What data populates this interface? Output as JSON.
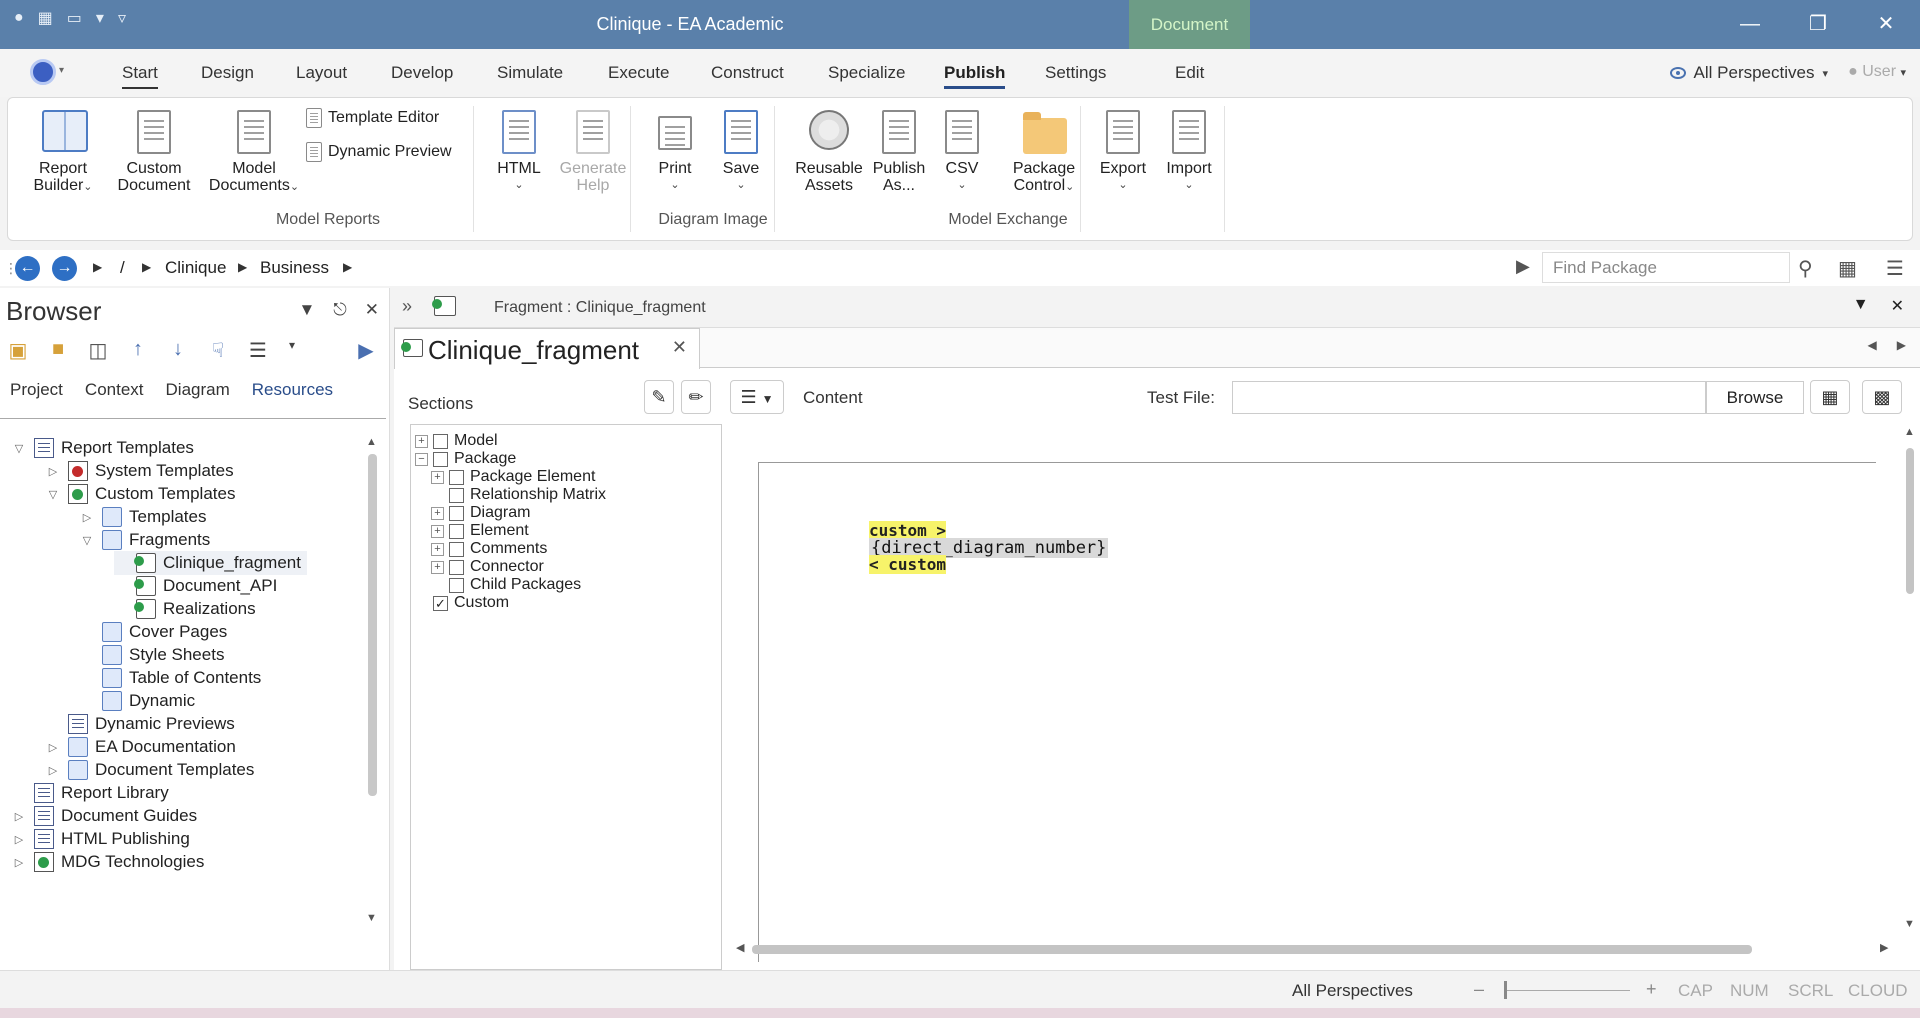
{
  "titlebar": {
    "title": "Clinique - EA Academic",
    "context_tab": "Document",
    "minimize": "—",
    "restore": "❐",
    "close": "✕"
  },
  "ribbon_tabs": {
    "start": "Start",
    "design": "Design",
    "layout": "Layout",
    "develop": "Develop",
    "simulate": "Simulate",
    "execute": "Execute",
    "construct": "Construct",
    "specialize": "Specialize",
    "publish": "Publish",
    "settings": "Settings",
    "edit": "Edit",
    "perspectives": "All Perspectives",
    "user": "User"
  },
  "ribbon": {
    "report_builder_1": "Report",
    "report_builder_2": "Builder",
    "custom_document_1": "Custom",
    "custom_document_2": "Document",
    "model_documents_1": "Model",
    "model_documents_2": "Documents",
    "template_editor": "Template Editor",
    "dynamic_preview": "Dynamic Preview",
    "html": "HTML",
    "generate_help_1": "Generate",
    "generate_help_2": "Help",
    "print": "Print",
    "save": "Save",
    "reusable_assets_1": "Reusable",
    "reusable_assets_2": "Assets",
    "publish_as_1": "Publish",
    "publish_as_2": "As...",
    "csv": "CSV",
    "package_control_1": "Package",
    "package_control_2": "Control",
    "export": "Export",
    "import": "Import",
    "group_model_reports": "Model Reports",
    "group_diagram_image": "Diagram Image",
    "group_model_exchange": "Model Exchange"
  },
  "navbar": {
    "root": "/",
    "crumb_1": "Clinique",
    "crumb_2": "Business",
    "find_placeholder": "Find Package"
  },
  "browser": {
    "title": "Browser",
    "tabs": {
      "project": "Project",
      "context": "Context",
      "diagram": "Diagram",
      "resources": "Resources"
    },
    "tree": {
      "report_templates": "Report Templates",
      "system_templates": "System Templates",
      "custom_templates": "Custom Templates",
      "templates": "Templates",
      "fragments": "Fragments",
      "clinique_fragment": "Clinique_fragment",
      "document_api": "Document_API",
      "realizations": "Realizations",
      "cover_pages": "Cover Pages",
      "style_sheets": "Style Sheets",
      "table_of_contents": "Table of Contents",
      "dynamic": "Dynamic",
      "dynamic_previews": "Dynamic Previews",
      "ea_documentation": "EA Documentation",
      "document_templates": "Document Templates",
      "report_library": "Report Library",
      "document_guides": "Document Guides",
      "html_publishing": "HTML Publishing",
      "mdg_technologies": "MDG Technologies"
    }
  },
  "document": {
    "header_title": "Fragment : Clinique_fragment",
    "tab_label": "Clinique_fragment",
    "sections_label": "Sections",
    "content_label": "Content",
    "test_file_label": "Test File:",
    "test_file_value": "",
    "browse": "Browse",
    "sections": {
      "model": "Model",
      "package": "Package",
      "package_element": "Package Element",
      "relationship_matrix": "Relationship Matrix",
      "diagram": "Diagram",
      "element": "Element",
      "comments": "Comments",
      "connector": "Connector",
      "child_packages": "Child Packages",
      "custom": "Custom"
    },
    "content": {
      "line1": "custom >",
      "line2": "{direct_diagram_number}",
      "line3": "< custom"
    }
  },
  "statusbar": {
    "perspectives": "All Perspectives",
    "zoom_minus": "–",
    "zoom_plus": "+",
    "cap": "CAP",
    "num": "NUM",
    "scrl": "SCRL",
    "cloud": "CLOUD"
  }
}
